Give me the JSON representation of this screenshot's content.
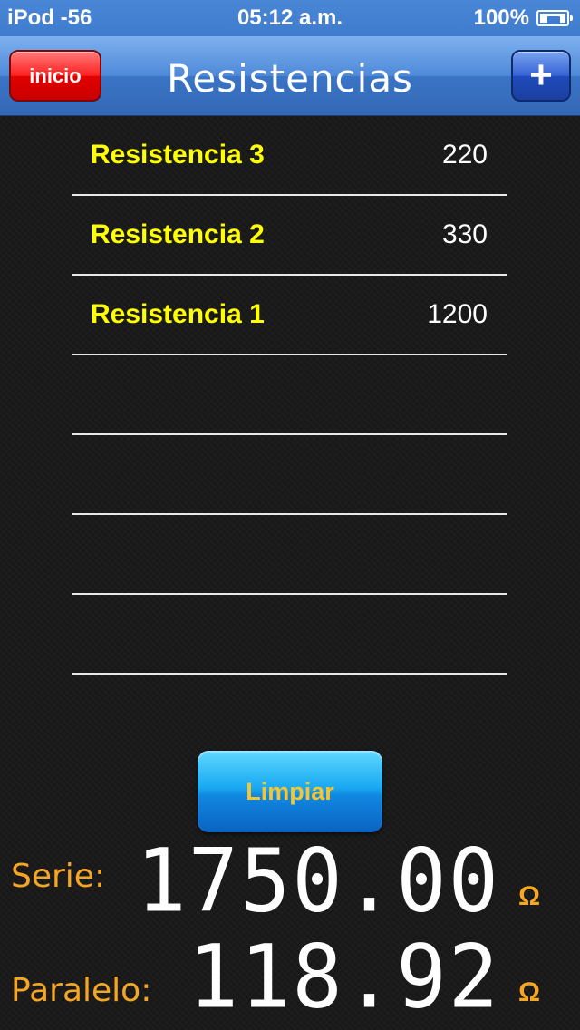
{
  "status_bar": {
    "carrier": "iPod -56",
    "time": "05:12 a.m.",
    "battery": "100%"
  },
  "nav": {
    "title": "Resistencias",
    "left_button": "inicio",
    "right_button": "+"
  },
  "list": {
    "rows": [
      {
        "name": "Resistencia 3",
        "value": "220"
      },
      {
        "name": "Resistencia 2",
        "value": "330"
      },
      {
        "name": "Resistencia 1",
        "value": "1200"
      },
      {
        "name": "",
        "value": ""
      },
      {
        "name": "",
        "value": ""
      },
      {
        "name": "",
        "value": ""
      },
      {
        "name": "",
        "value": ""
      }
    ]
  },
  "actions": {
    "clear_label": "Limpiar"
  },
  "results": {
    "serie_label": "Serie:",
    "serie_value": "1750.00",
    "paralelo_label": "Paralelo:",
    "paralelo_value": "118.92",
    "unit": "Ω"
  },
  "colors": {
    "label_accent": "#f5a623",
    "row_name": "#ffff00",
    "nav_blue": "#4f8ad9"
  }
}
